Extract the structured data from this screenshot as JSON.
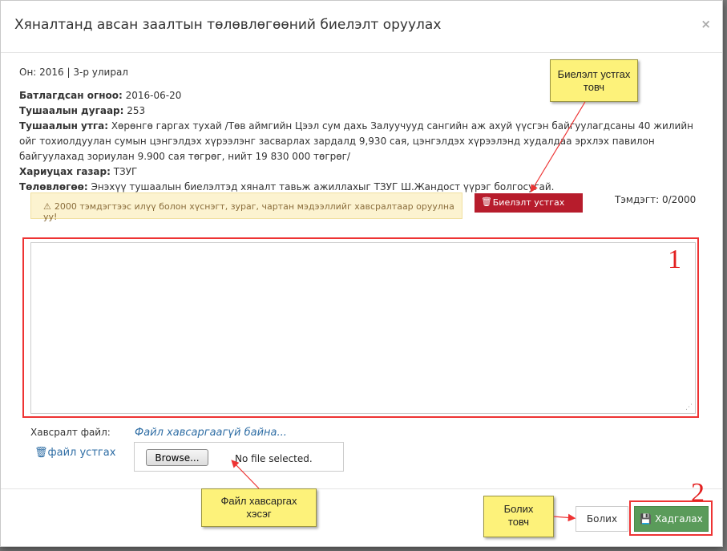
{
  "modal": {
    "title": "Хяналтанд авсан заалтын төлөвлөгөөний биелэлт оруулах",
    "close_label": "×"
  },
  "info": {
    "period": "Он: 2016 | 3-р улирал",
    "approved_label": "Батлагдсан огноо:",
    "approved_value": " 2016-06-20",
    "order_no_label": "Тушаалын дугаар:",
    "order_no_value": " 253",
    "order_content_label": "Тушаалын утга:",
    "order_content_value": " Хөрөнгө гаргах тухай /Төв аймгийн Цээл сум дахь Залуучууд сангийн аж ахуй үүсгэн байгуулагдсаны 40 жилийн ойг тохиолдуулан сумын цэнгэлдэх хүрээлэнг засварлах зардалд 9,930 сая, цэнгэлдэх хүрээлэнд худалдаа эрхлэх павилон байгуулахад зориулан 9.900 сая төгрөг, нийт 19 830 000 төгрөг/",
    "responsible_label": "Хариуцах газар:",
    "responsible_value": " ТЗУГ",
    "plan_label": "Төлөвлөгөө:",
    "plan_value": " Энэхүү тушаалын биелэлтэд хяналт тавьж ажиллахыг ТЗУГ Ш.Жандост үүрэг болгосугай."
  },
  "warning": {
    "icon": "warning-icon",
    "text": "2000 тэмдэгтээс илүү болон хүснэгт, зураг, чартан мэдээллийг хавсралтаар оруулна уу!"
  },
  "delete_button": {
    "icon": "trash-icon",
    "label": "Биелэлт устгах"
  },
  "counter": "Тэмдэгт: 0/2000",
  "attachment": {
    "label": "Хавсралт файл:",
    "no_file_text": "Файл хавсаргаагүй байна...",
    "delete_file_label": "файл устгах",
    "browse_label": "Browse...",
    "file_status": "No file selected."
  },
  "footer": {
    "cancel_label": "Болих",
    "save_label": "Хадгалах",
    "save_icon": "floppy-icon"
  },
  "annotations": {
    "delete_callout": "Биелэлт устгах товч",
    "file_callout": "Файл хавсаргах хэсэг",
    "cancel_callout": "Болих товч",
    "marker_1": "1",
    "marker_2": "2"
  },
  "colors": {
    "danger": "#b71c2c",
    "success": "#5a9b5a",
    "warning_bg": "#fcf3d0",
    "callout_bg": "#fdf27a",
    "annotation_red": "#e33333",
    "link": "#2e6da4"
  }
}
